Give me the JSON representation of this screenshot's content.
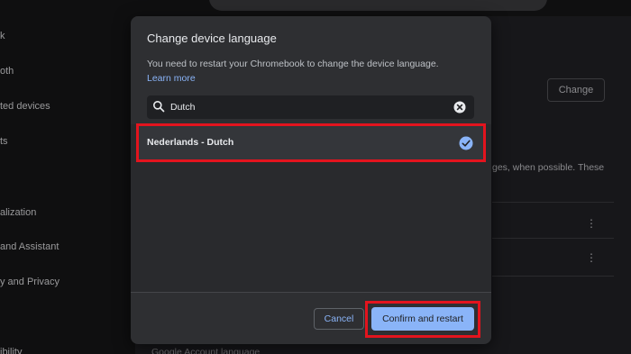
{
  "sidebar": {
    "items": [
      {
        "label": "k"
      },
      {
        "label": "oth"
      },
      {
        "label": "ted devices"
      },
      {
        "label": "ts"
      },
      {
        "label": "alization"
      },
      {
        "label": "and Assistant"
      },
      {
        "label": "y and Privacy"
      },
      {
        "label": "ibility"
      }
    ]
  },
  "background": {
    "change_label": "Change",
    "partial_text": "ges, when possible. These",
    "peek_text": "Google Account language"
  },
  "dialog": {
    "title": "Change device language",
    "description": "You need to restart your Chromebook to change the device language.",
    "learn_more": "Learn more",
    "search": {
      "value": "Dutch",
      "icon": "search-icon",
      "clear_icon": "clear-icon"
    },
    "results": [
      {
        "label": "Nederlands - Dutch",
        "selected": true
      }
    ],
    "cancel_label": "Cancel",
    "confirm_label": "Confirm and restart"
  },
  "colors": {
    "accent": "#8ab4f8",
    "dialog_bg": "#2e2f32",
    "highlight": "#e3141e"
  }
}
